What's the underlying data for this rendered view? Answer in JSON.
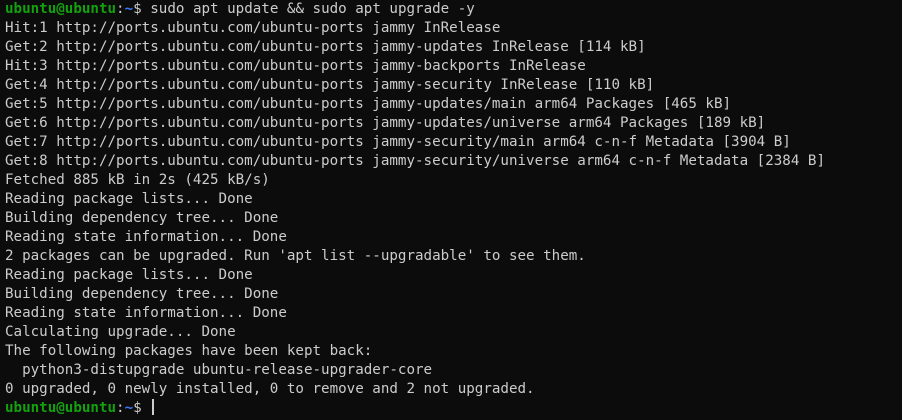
{
  "colors": {
    "background": "#0c0c0c",
    "foreground": "#cccccc",
    "prompt_user": "#13a10e",
    "prompt_path": "#3b78ff"
  },
  "prompt": {
    "user_host": "ubuntu@ubuntu",
    "separator": ":",
    "path": "~",
    "symbol": "$ "
  },
  "command": "sudo apt update && sudo apt upgrade -y",
  "output": [
    "Hit:1 http://ports.ubuntu.com/ubuntu-ports jammy InRelease",
    "Get:2 http://ports.ubuntu.com/ubuntu-ports jammy-updates InRelease [114 kB]",
    "Hit:3 http://ports.ubuntu.com/ubuntu-ports jammy-backports InRelease",
    "Get:4 http://ports.ubuntu.com/ubuntu-ports jammy-security InRelease [110 kB]",
    "Get:5 http://ports.ubuntu.com/ubuntu-ports jammy-updates/main arm64 Packages [465 kB]",
    "Get:6 http://ports.ubuntu.com/ubuntu-ports jammy-updates/universe arm64 Packages [189 kB]",
    "Get:7 http://ports.ubuntu.com/ubuntu-ports jammy-security/main arm64 c-n-f Metadata [3904 B]",
    "Get:8 http://ports.ubuntu.com/ubuntu-ports jammy-security/universe arm64 c-n-f Metadata [2384 B]",
    "Fetched 885 kB in 2s (425 kB/s)",
    "Reading package lists... Done",
    "Building dependency tree... Done",
    "Reading state information... Done",
    "2 packages can be upgraded. Run 'apt list --upgradable' to see them.",
    "Reading package lists... Done",
    "Building dependency tree... Done",
    "Reading state information... Done",
    "Calculating upgrade... Done",
    "The following packages have been kept back:",
    "  python3-distupgrade ubuntu-release-upgrader-core",
    "0 upgraded, 0 newly installed, 0 to remove and 2 not upgraded."
  ]
}
